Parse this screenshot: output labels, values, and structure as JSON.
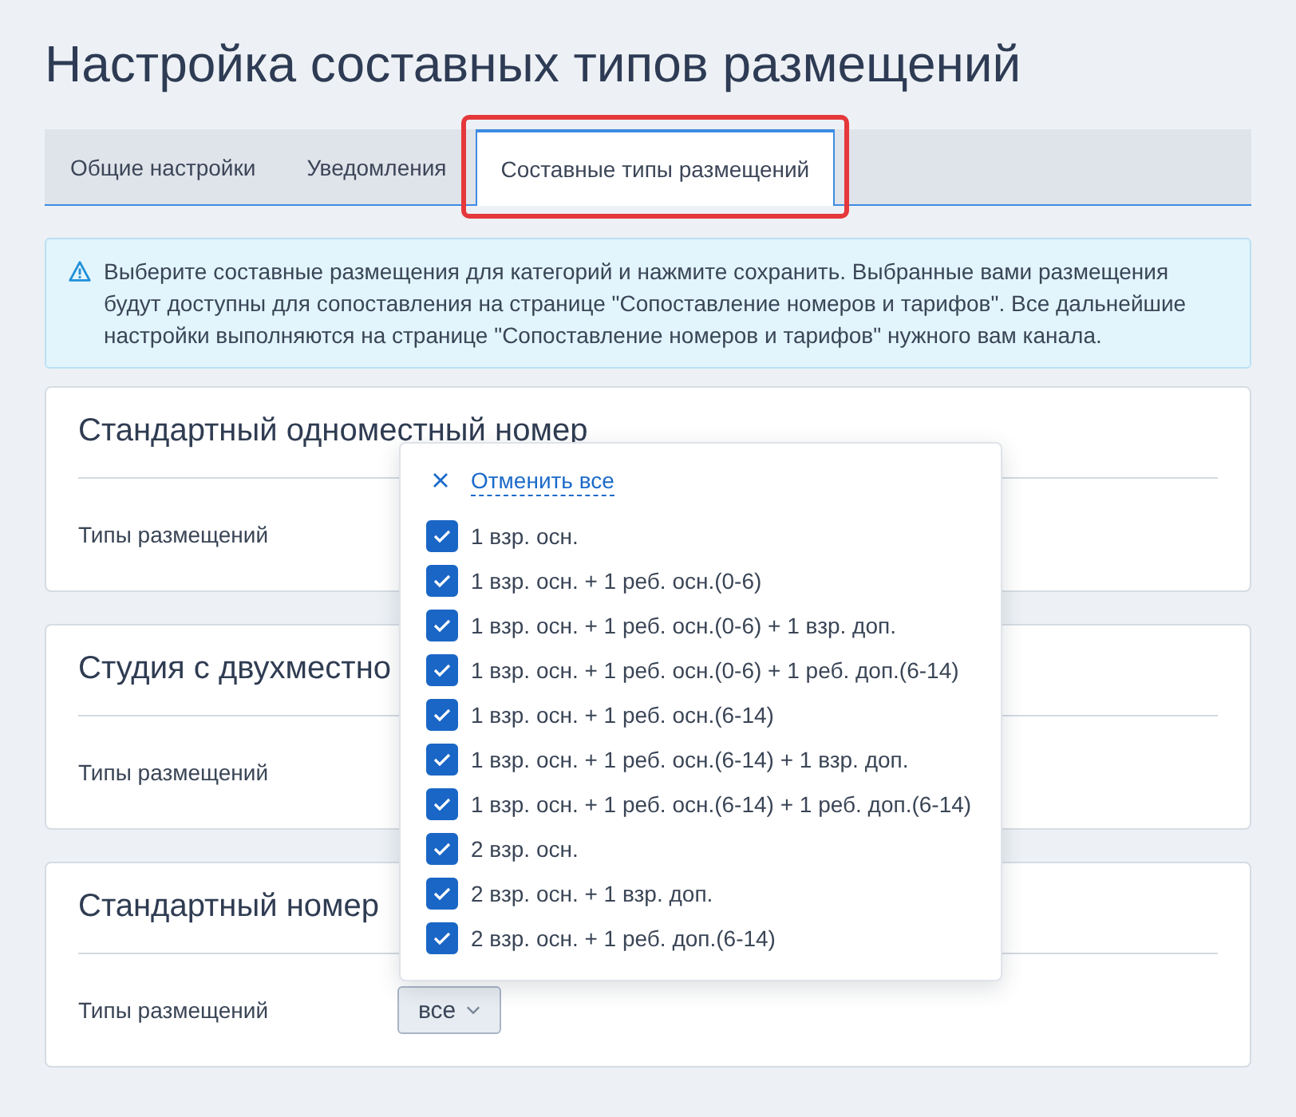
{
  "page": {
    "title": "Настройка составных типов размещений"
  },
  "tabs": [
    {
      "label": "Общие настройки",
      "selected": false,
      "highlighted": false
    },
    {
      "label": "Уведомления",
      "selected": false,
      "highlighted": false
    },
    {
      "label": "Составные типы размещений",
      "selected": true,
      "highlighted": true
    }
  ],
  "alert": {
    "kind": "warning",
    "text": "Выберите составные размещения для категорий и нажмите сохранить. Выбранные вами размещения будут доступны для сопоставления на странице \"Сопоставление номеров и тарифов\". Все дальнейшие настройки выполняются на странице \"Сопоставление номеров и тарифов\" нужного вам канала."
  },
  "categories": [
    {
      "title": "Стандартный одноместный номер",
      "field_label": "Типы размещений"
    },
    {
      "title": "Студия с двухместно",
      "field_label": "Типы размещений"
    },
    {
      "title": "Стандартный номер",
      "field_label": "Типы размещений",
      "select": {
        "value": "все",
        "expanded": true,
        "clear_label": "Отменить все",
        "options": [
          {
            "label": "1 взр. осн.",
            "checked": true
          },
          {
            "label": "1 взр. осн. + 1 реб. осн.(0-6)",
            "checked": true
          },
          {
            "label": "1 взр. осн. + 1 реб. осн.(0-6) + 1 взр. доп.",
            "checked": true
          },
          {
            "label": "1 взр. осн. + 1 реб. осн.(0-6) + 1 реб. доп.(6-14)",
            "checked": true
          },
          {
            "label": "1 взр. осн. + 1 реб. осн.(6-14)",
            "checked": true
          },
          {
            "label": "1 взр. осн. + 1 реб. осн.(6-14) + 1 взр. доп.",
            "checked": true
          },
          {
            "label": "1 взр. осн. + 1 реб. осн.(6-14) + 1 реб. доп.(6-14)",
            "checked": true
          },
          {
            "label": "2 взр. осн.",
            "checked": true
          },
          {
            "label": "2 взр. осн. + 1 взр. доп.",
            "checked": true
          },
          {
            "label": "2 взр. осн. + 1 реб. доп.(6-14)",
            "checked": true
          }
        ]
      }
    }
  ]
}
